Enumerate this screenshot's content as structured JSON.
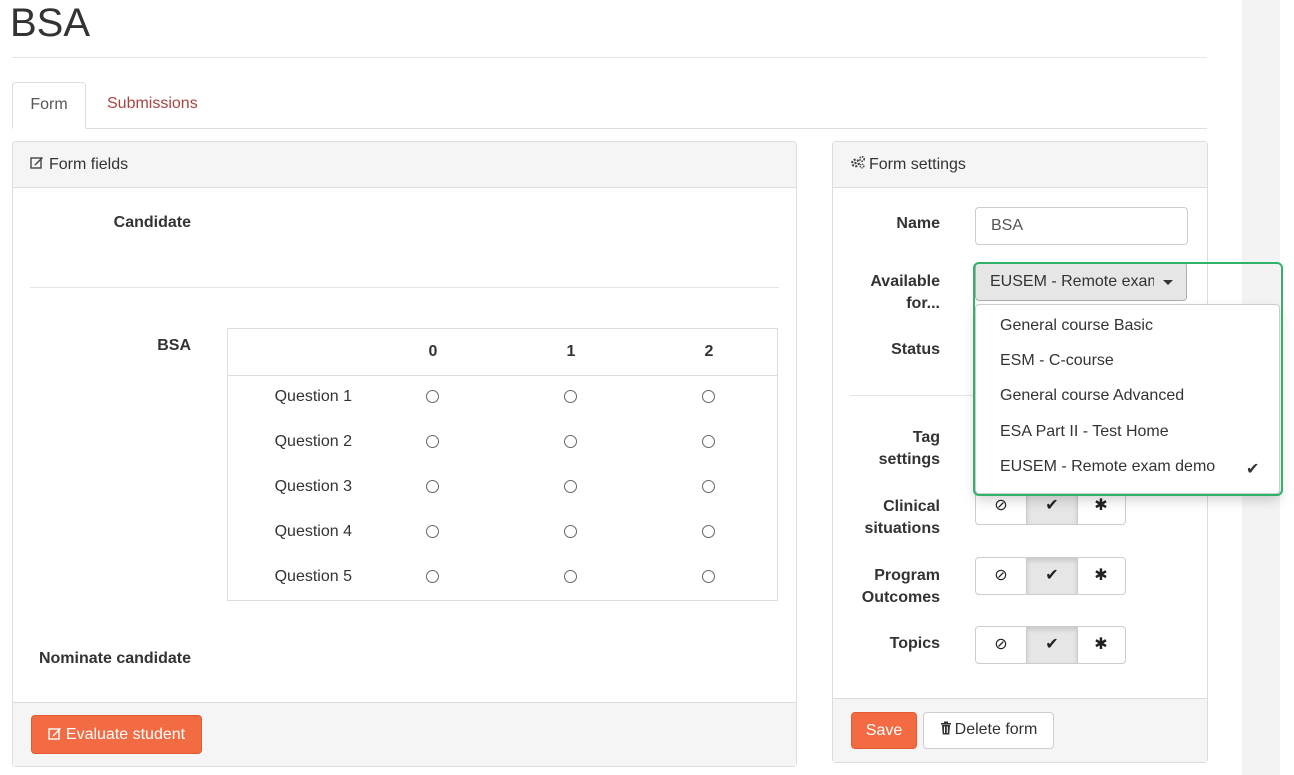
{
  "page": {
    "title": "BSA"
  },
  "tabs": [
    {
      "label": "Form",
      "active": true
    },
    {
      "label": "Submissions",
      "active": false
    }
  ],
  "form_fields": {
    "heading": "Form fields",
    "candidate_label": "Candidate",
    "bsa_label": "BSA",
    "columns": [
      "0",
      "1",
      "2"
    ],
    "questions": [
      "Question 1",
      "Question 2",
      "Question 3",
      "Question 4",
      "Question 5"
    ],
    "nominate_label": "Nominate candidate",
    "evaluate_button": "Evaluate student"
  },
  "form_settings": {
    "heading": "Form settings",
    "name_label": "Name",
    "name_value": "BSA",
    "available_label_1": "Available",
    "available_label_2": "for...",
    "available_selected": "EUSEM - Remote exam demo",
    "available_options": [
      {
        "label": "General course Basic",
        "checked": false
      },
      {
        "label": "ESM - C-course",
        "checked": false
      },
      {
        "label": "General course Advanced",
        "checked": false
      },
      {
        "label": "ESA Part II - Test Home",
        "checked": false
      },
      {
        "label": "EUSEM - Remote exam demo",
        "checked": true
      }
    ],
    "status_label": "Status",
    "tag_settings_label_1": "Tag",
    "tag_settings_label_2": "settings",
    "clinical_label_1": "Clinical",
    "clinical_label_2": "situations",
    "program_label_1": "Program",
    "program_label_2": "Outcomes",
    "topics_label": "Topics",
    "toggle_icons": [
      "ban-icon",
      "check-icon",
      "asterisk-icon"
    ],
    "toggle_selected": "check-icon",
    "save_button": "Save",
    "delete_button": "Delete form"
  },
  "colors": {
    "accent_orange": "#f26b43",
    "tab_link": "#a94442",
    "highlight_green": "#2fb36a"
  }
}
